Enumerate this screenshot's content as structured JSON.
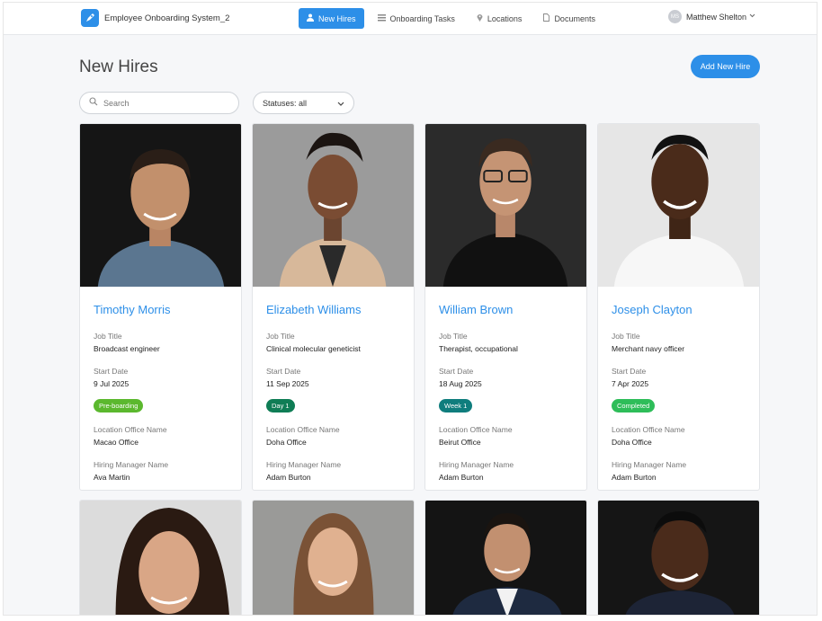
{
  "app": {
    "name": "Employee Onboarding System_2",
    "logo_icon": "rocket-icon"
  },
  "nav": [
    {
      "label": "New Hires",
      "icon": "user-icon",
      "active": true
    },
    {
      "label": "Onboarding Tasks",
      "icon": "list-icon",
      "active": false
    },
    {
      "label": "Locations",
      "icon": "pin-icon",
      "active": false
    },
    {
      "label": "Documents",
      "icon": "document-icon",
      "active": false
    }
  ],
  "user": {
    "initials": "MS",
    "name": "Matthew Shelton"
  },
  "page": {
    "title": "New Hires",
    "add_button": "Add New Hire",
    "search_placeholder": "Search",
    "status_filter": "Statuses: all"
  },
  "labels": {
    "job_title": "Job Title",
    "start_date": "Start Date",
    "location": "Location Office Name",
    "manager": "Hiring Manager Name"
  },
  "colors": {
    "accent": "#2d8fe8",
    "badge_preboarding": "#5bb82e",
    "badge_week1": "#0f7d7d",
    "badge_completed": "#2ebd59"
  },
  "hires": [
    {
      "name": "Timothy Morris",
      "job_title": "Broadcast engineer",
      "start_date": "9 Jul 2025",
      "status": "Pre-boarding",
      "status_color": "#5bb82e",
      "location": "Macao Office",
      "manager": "Ava Martin"
    },
    {
      "name": "Elizabeth Williams",
      "job_title": "Clinical molecular geneticist",
      "start_date": "11 Sep 2025",
      "status": "Day 1",
      "status_color": "#0f7d55",
      "location": "Doha Office",
      "manager": "Adam Burton"
    },
    {
      "name": "William Brown",
      "job_title": "Therapist, occupational",
      "start_date": "18 Aug 2025",
      "status": "Week 1",
      "status_color": "#0f7d7d",
      "location": "Beirut Office",
      "manager": "Adam Burton"
    },
    {
      "name": "Joseph Clayton",
      "job_title": "Merchant navy officer",
      "start_date": "7 Apr 2025",
      "status": "Completed",
      "status_color": "#2ebd59",
      "location": "Doha Office",
      "manager": "Adam Burton"
    }
  ]
}
